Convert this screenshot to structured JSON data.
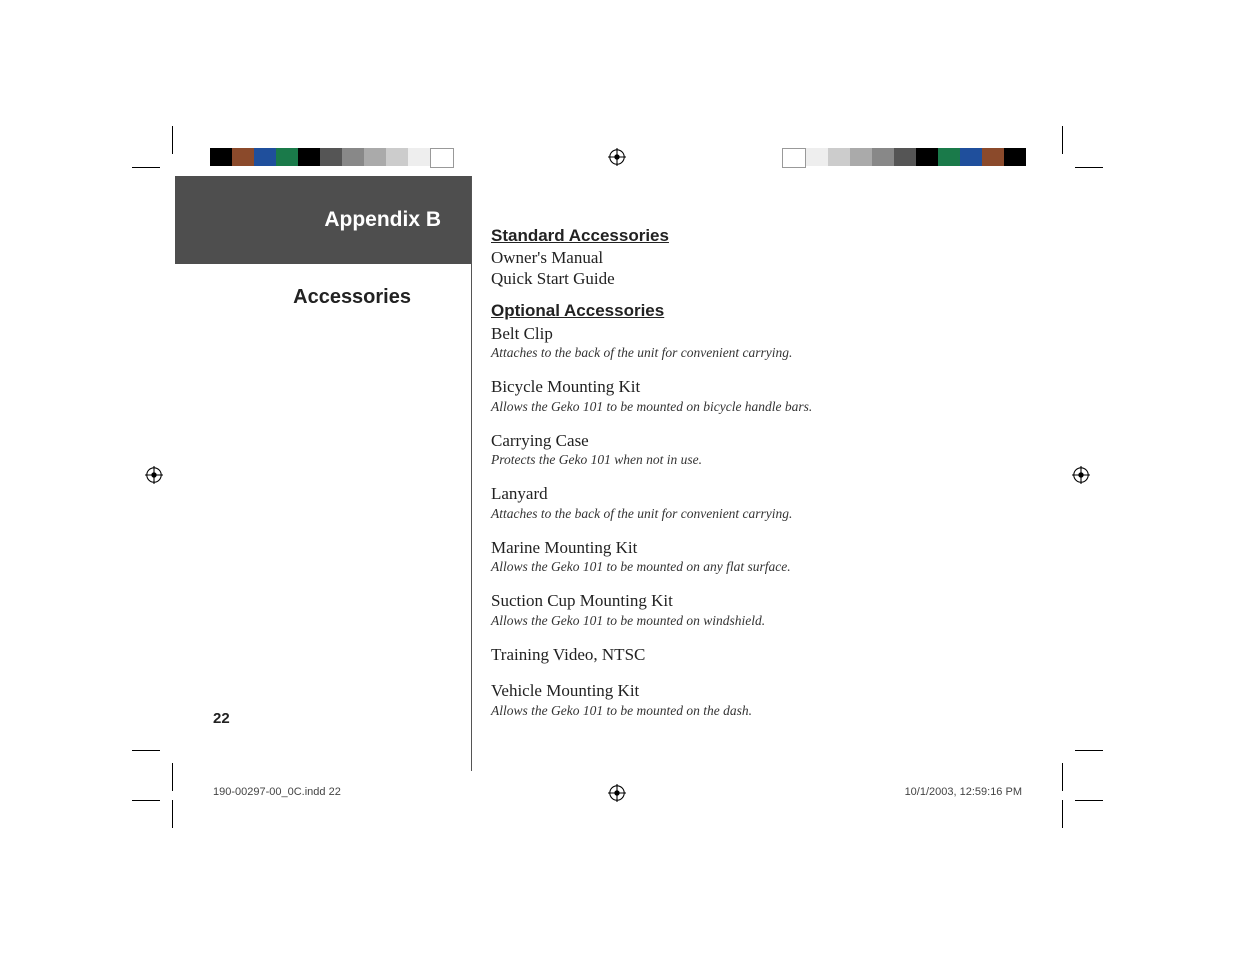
{
  "appendix_label": "Appendix B",
  "section_title": "Accessories",
  "page_number": "22",
  "standard": {
    "heading": "Standard Accessories",
    "items": [
      {
        "name": "Owner's Manual"
      },
      {
        "name": "Quick Start Guide"
      }
    ]
  },
  "optional": {
    "heading": "Optional Accessories",
    "items": [
      {
        "name": "Belt Clip",
        "desc": "Attaches to the back of the unit for convenient carrying."
      },
      {
        "name": "Bicycle Mounting Kit",
        "desc": "Allows the Geko 101 to be mounted on bicycle handle bars."
      },
      {
        "name": "Carrying Case",
        "desc": "Protects the Geko 101 when not in use."
      },
      {
        "name": "Lanyard",
        "desc": "Attaches to the back of the unit for convenient carrying."
      },
      {
        "name": "Marine Mounting Kit",
        "desc": "Allows the Geko 101 to be mounted on any flat surface."
      },
      {
        "name": "Suction Cup Mounting Kit",
        "desc": "Allows the Geko 101 to be mounted on windshield."
      },
      {
        "name": "Training Video, NTSC"
      },
      {
        "name": "Vehicle Mounting Kit",
        "desc": "Allows the Geko 101 to be mounted on the dash."
      }
    ]
  },
  "slug": {
    "file": "190-00297-00_0C.indd   22",
    "timestamp": "10/1/2003, 12:59:16 PM"
  },
  "swatches_left": [
    "#000000",
    "#8b4a2b",
    "#1f4f9c",
    "#1a7a4a",
    "#000000",
    "#555555",
    "#888888",
    "#aaaaaa",
    "#cccccc",
    "#eeeeee",
    "#ffffff"
  ],
  "swatches_right": [
    "#ffffff",
    "#eeeeee",
    "#cccccc",
    "#aaaaaa",
    "#888888",
    "#555555",
    "#000000",
    "#1a7a4a",
    "#1f4f9c",
    "#8b4a2b",
    "#000000"
  ]
}
